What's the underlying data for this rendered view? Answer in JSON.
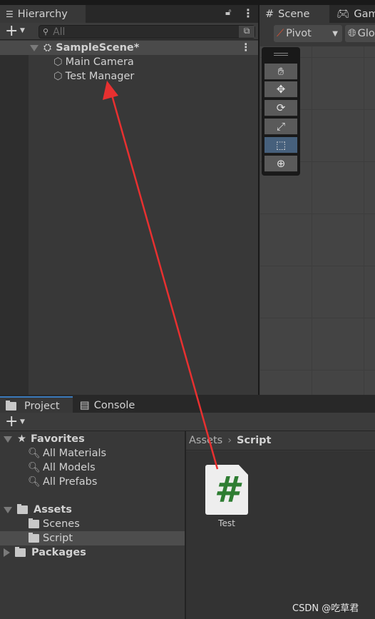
{
  "hierarchy": {
    "tab": "Hierarchy",
    "search_placeholder": "All",
    "scene": "SampleScene*",
    "items": [
      "Main Camera",
      "Test Manager"
    ]
  },
  "scene_panel": {
    "tabs": [
      "Scene",
      "Game"
    ],
    "pivot": "Pivot",
    "global": "Global"
  },
  "bottom": {
    "tabs": [
      "Project",
      "Console"
    ],
    "favorites": {
      "label": "Favorites",
      "items": [
        "All Materials",
        "All Models",
        "All Prefabs"
      ]
    },
    "assets": {
      "label": "Assets",
      "items": [
        "Scenes",
        "Script"
      ]
    },
    "packages": "Packages",
    "breadcrumb": [
      "Assets",
      "Script"
    ],
    "files": [
      {
        "name": "Test",
        "type": "C# script"
      }
    ]
  },
  "watermark": "CSDN @吃草君",
  "colors": {
    "arrow": "#e83030",
    "script_icon": "#2e7d32",
    "selection": "#4d4d4d"
  }
}
